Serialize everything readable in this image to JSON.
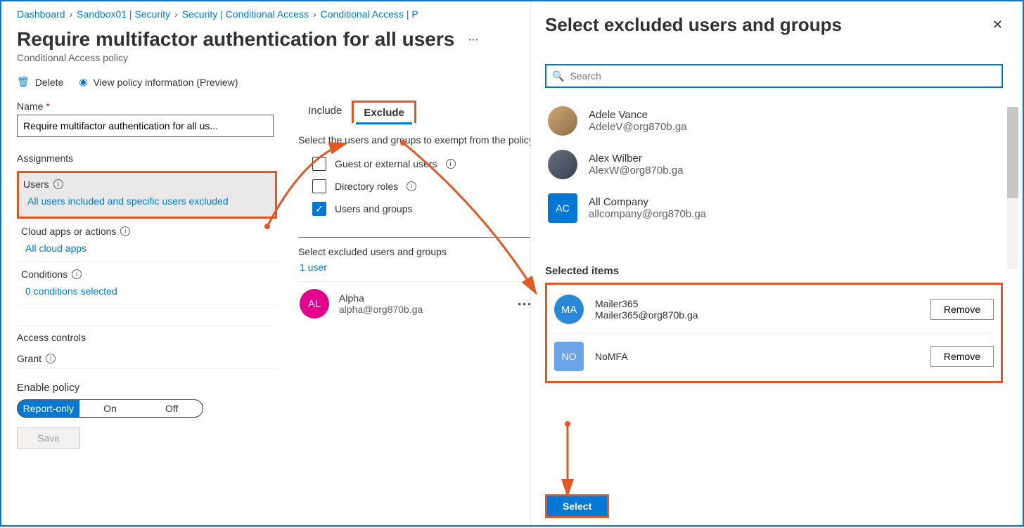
{
  "breadcrumb": [
    "Dashboard",
    "Sandbox01 | Security",
    "Security | Conditional Access",
    "Conditional Access | P"
  ],
  "page": {
    "title": "Require multifactor authentication for all users",
    "subtitle": "Conditional Access policy",
    "more": "···"
  },
  "toolbar": {
    "delete": "Delete",
    "view_info": "View policy information (Preview)"
  },
  "name_field": {
    "label": "Name",
    "value": "Require multifactor authentication for all us..."
  },
  "assignments": {
    "heading": "Assignments",
    "users": {
      "label": "Users",
      "summary": "All users included and specific users excluded"
    },
    "apps": {
      "label": "Cloud apps or actions",
      "summary": "All cloud apps"
    },
    "conditions": {
      "label": "Conditions",
      "summary": "0 conditions selected"
    }
  },
  "tabs": {
    "include": "Include",
    "exclude": "Exclude"
  },
  "exclude_desc": "Select the users and groups to exempt from the policy",
  "checks": {
    "guest": "Guest or external users",
    "roles": "Directory roles",
    "users_groups": "Users and groups"
  },
  "excluded_section": {
    "heading": "Select excluded users and groups",
    "count_link": "1 user"
  },
  "excluded_user": {
    "initials": "AL",
    "name": "Alpha",
    "email": "alpha@org870b.ga",
    "color": "#e3008c"
  },
  "access": {
    "heading": "Access controls",
    "grant": "Grant"
  },
  "enable": {
    "heading": "Enable policy",
    "options": [
      "Report-only",
      "On",
      "Off"
    ],
    "active": "Report-only"
  },
  "save_label": "Save",
  "panel": {
    "title": "Select excluded users and groups",
    "search_placeholder": "Search",
    "results": [
      {
        "name": "Adele Vance",
        "email": "AdeleV@org870b.ga",
        "type": "photo"
      },
      {
        "name": "Alex Wilber",
        "email": "AlexW@org870b.ga",
        "type": "photo"
      },
      {
        "name": "All Company",
        "email": "allcompany@org870b.ga",
        "type": "square",
        "initials": "AC",
        "color": "#0078d4"
      }
    ],
    "selected_heading": "Selected items",
    "selected": [
      {
        "name": "Mailer365",
        "email": "Mailer365@org870b.ga",
        "initials": "MA",
        "shape": "circle",
        "color": "#2b88d8"
      },
      {
        "name": "NoMFA",
        "email": "",
        "initials": "NO",
        "shape": "square",
        "color": "#6ba5e7"
      }
    ],
    "remove_label": "Remove",
    "select_label": "Select"
  }
}
